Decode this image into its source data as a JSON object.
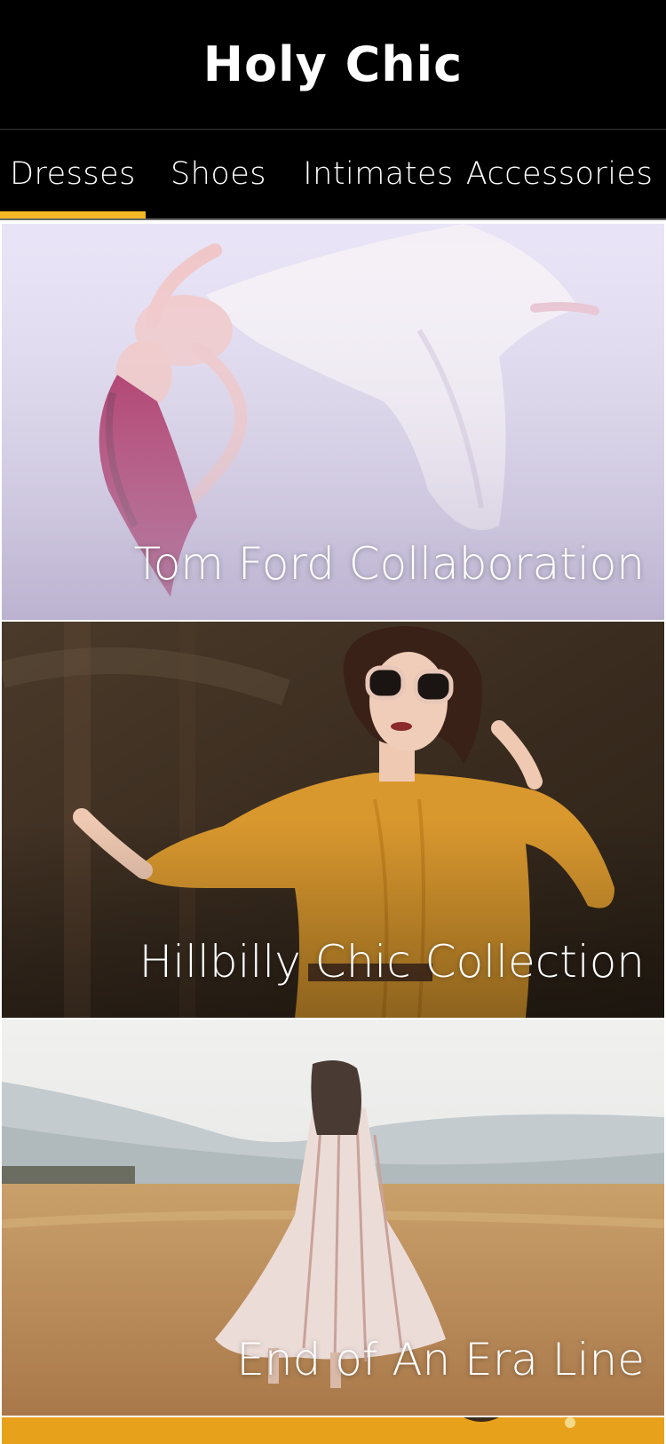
{
  "header": {
    "title": "Holy Chic"
  },
  "tabs": [
    {
      "label": "Dresses",
      "active": true
    },
    {
      "label": "Shoes",
      "active": false
    },
    {
      "label": "Intimates",
      "active": false
    },
    {
      "label": "Accessories",
      "active": false
    }
  ],
  "accent_color": "#f3b925",
  "cards": [
    {
      "label": "Tom Ford Collaboration",
      "image": "woman-floating-white-dress-photo"
    },
    {
      "label": "Hillbilly Chic Collection",
      "image": "woman-sunglasses-mustard-dress-photo"
    },
    {
      "label": "End of An Era Line",
      "image": "woman-striped-dress-field-photo"
    },
    {
      "label": "",
      "image": "yellow-collection-photo"
    }
  ]
}
